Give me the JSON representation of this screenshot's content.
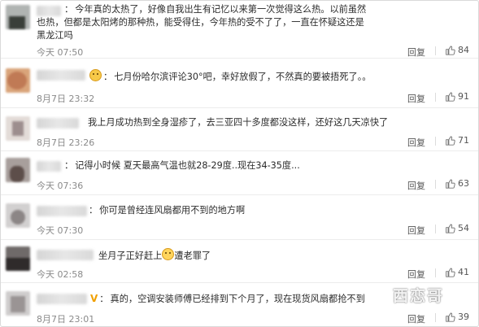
{
  "labels": {
    "reply": "回复"
  },
  "comments": [
    {
      "text": "今年真的太热了，好像自我出生有记忆以来第一次觉得这么热。以前虽然也热，但都是太阳烤的那种热，能受得住，今年热的受不了了，一直在怀疑这还是黑龙江吗",
      "time": "今天 07:50",
      "likes": "84"
    },
    {
      "text": "七月份哈尔滨评论30°吧，幸好放假了，不然真的要被捂死了。。",
      "time": "8月7日 23:32",
      "likes": "91"
    },
    {
      "text": "我上月成功热到全身湿疹了，去三亚四十多度都没这样，还好这几天凉快了",
      "time": "8月7日 23:26",
      "likes": "71"
    },
    {
      "text": "记得小时候 夏天最高气温也就28-29度..现在34-35度...",
      "time": "今天 07:36",
      "likes": "63"
    },
    {
      "text": "你可是曾经连风扇都用不到的地方啊",
      "time": "今天 07:30",
      "likes": "54"
    },
    {
      "text_before": "坐月子正好赶上",
      "text_after": "遭老罪了",
      "time": "今天 02:58",
      "likes": "41"
    },
    {
      "text": "真的，空调安装师傅已经排到下个月了，现在现货风扇都抢不到",
      "time": "8月7日 23:01",
      "likes": "39"
    }
  ],
  "watermark": "西恋哥"
}
